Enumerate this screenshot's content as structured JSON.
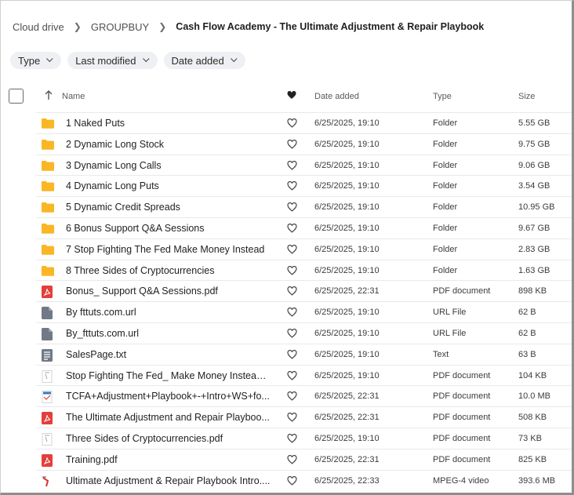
{
  "breadcrumb": {
    "root": "Cloud drive",
    "parent": "GROUPBUY",
    "current": "Cash Flow Academy - The Ultimate Adjustment & Repair Playbook"
  },
  "filters": [
    {
      "label": "Type"
    },
    {
      "label": "Last modified"
    },
    {
      "label": "Date added"
    }
  ],
  "columns": {
    "name": "Name",
    "date_added": "Date added",
    "type": "Type",
    "size": "Size"
  },
  "colors": {
    "folder": "#f9b625",
    "pdf": "#e2403b",
    "generic_file": "#707a86",
    "pdf_outline": "#c7ccd2",
    "accent_video": "#d8302f"
  },
  "files": [
    {
      "name": "1 Naked Puts",
      "date": "6/25/2025, 19:10",
      "type": "Folder",
      "size": "5.55 GB",
      "icon": "folder-icon"
    },
    {
      "name": "2 Dynamic Long Stock",
      "date": "6/25/2025, 19:10",
      "type": "Folder",
      "size": "9.75 GB",
      "icon": "folder-icon"
    },
    {
      "name": "3 Dynamic Long Calls",
      "date": "6/25/2025, 19:10",
      "type": "Folder",
      "size": "9.06 GB",
      "icon": "folder-icon"
    },
    {
      "name": "4 Dynamic Long Puts",
      "date": "6/25/2025, 19:10",
      "type": "Folder",
      "size": "3.54 GB",
      "icon": "folder-icon"
    },
    {
      "name": "5 Dynamic Credit Spreads",
      "date": "6/25/2025, 19:10",
      "type": "Folder",
      "size": "10.95 GB",
      "icon": "folder-icon"
    },
    {
      "name": "6 Bonus Support Q&A Sessions",
      "date": "6/25/2025, 19:10",
      "type": "Folder",
      "size": "9.67 GB",
      "icon": "folder-icon"
    },
    {
      "name": "7 Stop Fighting The Fed Make Money Instead",
      "date": "6/25/2025, 19:10",
      "type": "Folder",
      "size": "2.83 GB",
      "icon": "folder-icon"
    },
    {
      "name": "8 Three Sides of Cryptocurrencies",
      "date": "6/25/2025, 19:10",
      "type": "Folder",
      "size": "1.63 GB",
      "icon": "folder-icon"
    },
    {
      "name": "Bonus_ Support Q&A Sessions.pdf",
      "date": "6/25/2025, 22:31",
      "type": "PDF document",
      "size": "898 KB",
      "icon": "pdf-icon"
    },
    {
      "name": "By fttuts.com.url",
      "date": "6/25/2025, 19:10",
      "type": "URL File",
      "size": "62 B",
      "icon": "file-icon"
    },
    {
      "name": "By_fttuts.com.url",
      "date": "6/25/2025, 19:10",
      "type": "URL File",
      "size": "62 B",
      "icon": "file-icon"
    },
    {
      "name": "SalesPage.txt",
      "date": "6/25/2025, 19:10",
      "type": "Text",
      "size": "63 B",
      "icon": "text-file-icon"
    },
    {
      "name": "Stop Fighting The Fed_ Make Money Instead!...",
      "date": "6/25/2025, 19:10",
      "type": "PDF document",
      "size": "104 KB",
      "icon": "pdf-thumbnail-icon"
    },
    {
      "name": "TCFA+Adjustment+Playbook+-+Intro+WS+fo...",
      "date": "6/25/2025, 22:31",
      "type": "PDF document",
      "size": "10.0 MB",
      "icon": "pdf-thumbnail-color-icon"
    },
    {
      "name": "The Ultimate Adjustment and Repair Playboo...",
      "date": "6/25/2025, 22:31",
      "type": "PDF document",
      "size": "508 KB",
      "icon": "pdf-icon"
    },
    {
      "name": "Three Sides of Cryptocurrencies.pdf",
      "date": "6/25/2025, 19:10",
      "type": "PDF document",
      "size": "73 KB",
      "icon": "pdf-thumbnail-icon"
    },
    {
      "name": "Training.pdf",
      "date": "6/25/2025, 22:31",
      "type": "PDF document",
      "size": "825 KB",
      "icon": "pdf-icon"
    },
    {
      "name": "Ultimate Adjustment & Repair Playbook Intro....",
      "date": "6/25/2025, 22:33",
      "type": "MPEG-4 video",
      "size": "393.6 MB",
      "icon": "video-thumbnail-icon"
    }
  ]
}
